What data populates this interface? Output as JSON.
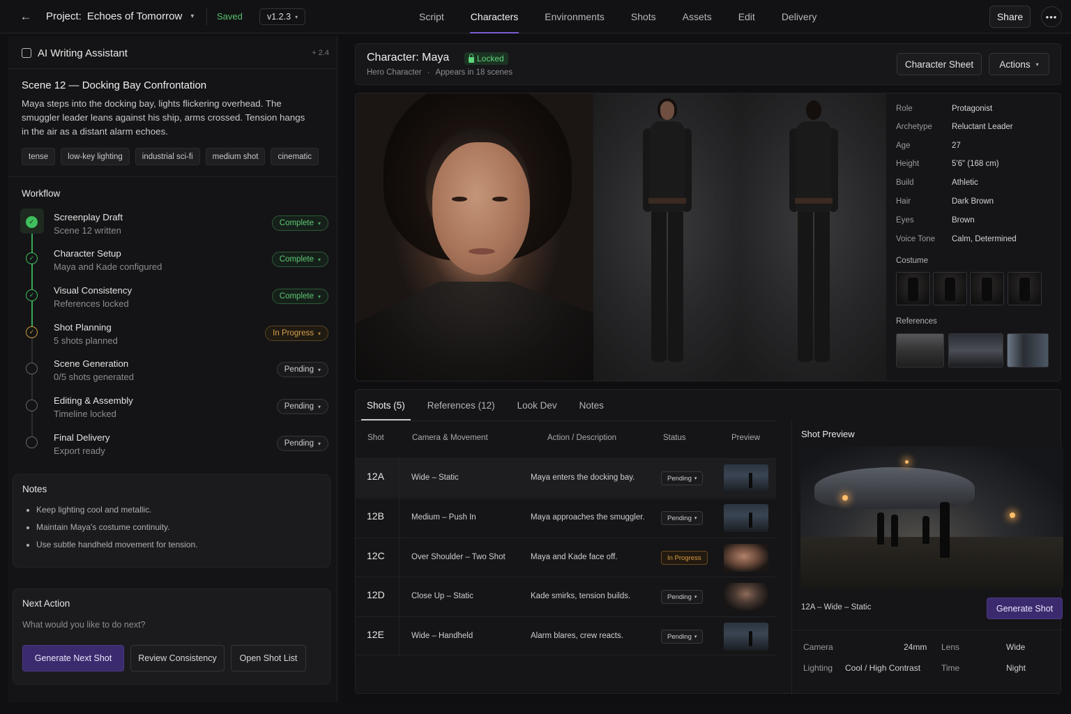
{
  "topbar": {
    "project_label": "Project:",
    "project_name": "Echoes of Tomorrow",
    "saved": "Saved",
    "version": "v1.2.3",
    "tabs": [
      {
        "label": "Script"
      },
      {
        "label": "Characters"
      },
      {
        "label": "Environments"
      },
      {
        "label": "Shots"
      },
      {
        "label": "Assets"
      },
      {
        "label": "Edit"
      },
      {
        "label": "Delivery"
      }
    ],
    "active_tab": "Characters",
    "share": "Share",
    "more": "•••"
  },
  "assistant": {
    "title": "AI Writing Assistant",
    "version": "+ 2.4",
    "scene_title": "Scene 12 — Docking Bay Confrontation",
    "scene_desc": "Maya steps into the docking bay, lights flickering overhead. The smuggler leader leans against his ship, arms crossed. Tension hangs in the air as a distant alarm echoes.",
    "tags": [
      "tense",
      "low-key lighting",
      "industrial sci-fi",
      "medium shot",
      "cinematic"
    ],
    "workflow_title": "Workflow",
    "workflow": [
      {
        "name": "Screenplay Draft",
        "sub": "Scene 12 written",
        "status": "Complete"
      },
      {
        "name": "Character Setup",
        "sub": "Maya and Kade configured",
        "status": "Complete"
      },
      {
        "name": "Visual Consistency",
        "sub": "References locked",
        "status": "Complete"
      },
      {
        "name": "Shot Planning",
        "sub": "5 shots planned",
        "status": "In Progress"
      },
      {
        "name": "Scene Generation",
        "sub": "0/5 shots generated",
        "status": "Pending"
      },
      {
        "name": "Editing & Assembly",
        "sub": "Timeline locked",
        "status": "Pending"
      },
      {
        "name": "Final Delivery",
        "sub": "Export ready",
        "status": "Pending"
      }
    ],
    "notes_title": "Notes",
    "notes": [
      "Keep lighting cool and metallic.",
      "Maintain Maya's costume continuity.",
      "Use subtle handheld movement for tension."
    ],
    "next_title": "Next Action",
    "next_sub": "What would you like to do next?",
    "buttons": [
      "Generate Next Shot",
      "Review Consistency",
      "Open Shot List"
    ]
  },
  "character": {
    "title": "Character: Maya",
    "locked": "Locked",
    "type": "Hero Character",
    "dot": "·",
    "appears": "Appears in 18 scenes",
    "sheet_btn": "Character Sheet",
    "actions_btn": "Actions",
    "specs": [
      {
        "k": "Role",
        "v": "Protagonist"
      },
      {
        "k": "Archetype",
        "v": "Reluctant Leader"
      },
      {
        "k": "Age",
        "v": "27"
      },
      {
        "k": "Height",
        "v": "5'6\" (168 cm)"
      },
      {
        "k": "Build",
        "v": "Athletic"
      },
      {
        "k": "Hair",
        "v": "Dark Brown"
      },
      {
        "k": "Eyes",
        "v": "Brown"
      },
      {
        "k": "Voice Tone",
        "v": "Calm, Determined"
      }
    ],
    "costume_label": "Costume",
    "references_label": "References"
  },
  "shots": {
    "tabs": [
      "Shots (5)",
      "References (12)",
      "Look Dev",
      "Notes"
    ],
    "headers": [
      "Shot",
      "Camera & Movement",
      "Action / Description",
      "Status",
      "Preview"
    ],
    "rows": [
      {
        "id": "12A",
        "camera": "Wide – Static",
        "action": "Maya enters the docking bay.",
        "status": "Pending"
      },
      {
        "id": "12B",
        "camera": "Medium – Push In",
        "action": "Maya approaches the smuggler.",
        "status": "Pending"
      },
      {
        "id": "12C",
        "camera": "Over Shoulder – Two Shot",
        "action": "Maya and Kade face off.",
        "status": "In Progress"
      },
      {
        "id": "12D",
        "camera": "Close Up – Static",
        "action": "Kade smirks, tension builds.",
        "status": "Pending"
      },
      {
        "id": "12E",
        "camera": "Wide – Handheld",
        "action": "Alarm blares, crew reacts.",
        "status": "Pending"
      }
    ]
  },
  "preview": {
    "title": "Shot Preview",
    "caption": "12A – Wide – Static",
    "generate": "Generate Shot",
    "camera_k": "Camera",
    "camera_v": "24mm",
    "lens_k": "Lens",
    "lens_v": "Wide",
    "lighting_k": "Lighting",
    "lighting_v": "Cool / High Contrast",
    "time_k": "Time",
    "time_v": "Night"
  },
  "colors": {
    "accent": "#7b5cd6",
    "complete": "#3fbf5d",
    "progress": "#d7a14a",
    "primary_button": "#3b2a6d"
  }
}
